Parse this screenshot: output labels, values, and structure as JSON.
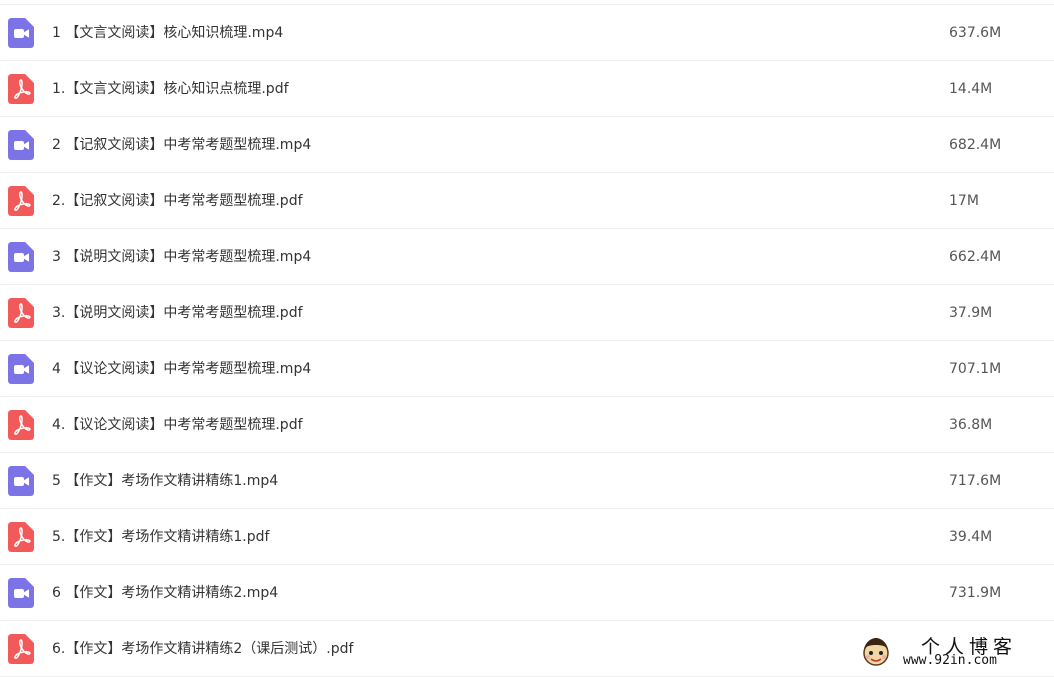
{
  "colors": {
    "video_icon": "#7C73E6",
    "pdf_icon": "#F25A5A",
    "divider": "#EEEEEE",
    "text": "#333333"
  },
  "files": [
    {
      "type": "video",
      "icon": "video-camera-icon",
      "name": "1 【文言文阅读】核心知识梳理.mp4",
      "size": "637.6M"
    },
    {
      "type": "pdf",
      "icon": "pdf-icon",
      "name": "1.【文言文阅读】核心知识点梳理.pdf",
      "size": "14.4M"
    },
    {
      "type": "video",
      "icon": "video-camera-icon",
      "name": "2 【记叙文阅读】中考常考题型梳理.mp4",
      "size": "682.4M"
    },
    {
      "type": "pdf",
      "icon": "pdf-icon",
      "name": "2.【记叙文阅读】中考常考题型梳理.pdf",
      "size": "17M"
    },
    {
      "type": "video",
      "icon": "video-camera-icon",
      "name": "3 【说明文阅读】中考常考题型梳理.mp4",
      "size": "662.4M"
    },
    {
      "type": "pdf",
      "icon": "pdf-icon",
      "name": "3.【说明文阅读】中考常考题型梳理.pdf",
      "size": "37.9M"
    },
    {
      "type": "video",
      "icon": "video-camera-icon",
      "name": "4 【议论文阅读】中考常考题型梳理.mp4",
      "size": "707.1M"
    },
    {
      "type": "pdf",
      "icon": "pdf-icon",
      "name": "4.【议论文阅读】中考常考题型梳理.pdf",
      "size": "36.8M"
    },
    {
      "type": "video",
      "icon": "video-camera-icon",
      "name": "5 【作文】考场作文精讲精练1.mp4",
      "size": "717.6M"
    },
    {
      "type": "pdf",
      "icon": "pdf-icon",
      "name": "5.【作文】考场作文精讲精练1.pdf",
      "size": "39.4M"
    },
    {
      "type": "video",
      "icon": "video-camera-icon",
      "name": "6 【作文】考场作文精讲精练2.mp4",
      "size": "731.9M"
    },
    {
      "type": "pdf",
      "icon": "pdf-icon",
      "name": "6.【作文】考场作文精讲精练2（课后测试）.pdf",
      "size": ""
    }
  ],
  "watermark": {
    "title": "个人博客",
    "url": "www.92in.com"
  }
}
